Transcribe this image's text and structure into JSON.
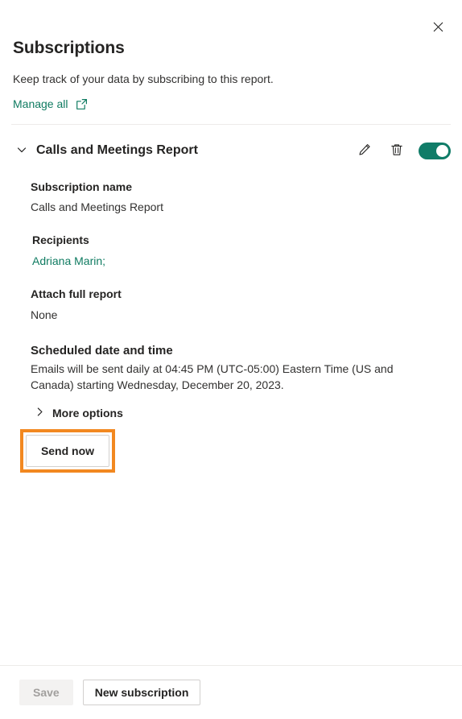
{
  "panel": {
    "title": "Subscriptions",
    "subtitle": "Keep track of your data by subscribing to this report.",
    "manage_all_label": "Manage all",
    "close_icon": "close-icon",
    "external_link_icon": "open-in-new-window-icon"
  },
  "subscription": {
    "name": "Calls and Meetings Report",
    "expanded": true,
    "expand_icon": "chevron-down-icon",
    "edit_icon": "pencil-icon",
    "delete_icon": "trash-icon",
    "toggle_state": "on",
    "fields": {
      "name_label": "Subscription name",
      "name_value": "Calls and Meetings Report",
      "recipients_label": "Recipients",
      "recipients_value": "Adriana Marin;",
      "attach_label": "Attach full report",
      "attach_value": "None",
      "schedule_label": "Scheduled date and time",
      "schedule_value": "Emails will be sent daily at 04:45 PM (UTC-05:00) Eastern Time (US and Canada) starting Wednesday, December 20, 2023."
    },
    "more_options_label": "More options",
    "more_options_icon": "chevron-right-icon",
    "send_now_label": "Send now"
  },
  "footer": {
    "save_label": "Save",
    "save_disabled": true,
    "new_subscription_label": "New subscription"
  },
  "colors": {
    "accent_green": "#0F7B61",
    "toggle_on": "#107C68",
    "highlight_orange": "#F28820",
    "text_primary": "#252423",
    "divider": "#EDEBE9"
  }
}
